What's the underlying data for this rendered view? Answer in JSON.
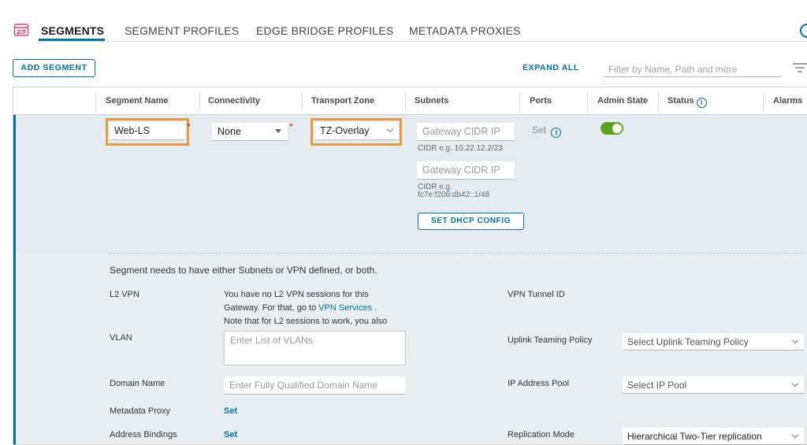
{
  "tabs": [
    {
      "label": "SEGMENTS",
      "active": true
    },
    {
      "label": "SEGMENT PROFILES",
      "active": false
    },
    {
      "label": "EDGE BRIDGE PROFILES",
      "active": false
    },
    {
      "label": "METADATA PROXIES",
      "active": false
    }
  ],
  "toolbar": {
    "add_label": "ADD SEGMENT",
    "expand_label": "EXPAND ALL",
    "filter_placeholder": "Filter by Name, Path and more"
  },
  "columns": {
    "segment_name": "Segment Name",
    "connectivity": "Connectivity",
    "transport_zone": "Transport Zone",
    "subnets": "Subnets",
    "ports": "Ports",
    "admin_state": "Admin State",
    "status": "Status",
    "alarms": "Alarms"
  },
  "row": {
    "segment_name": "Web-LS",
    "connectivity": "None",
    "transport_zone": "TZ-Overlay",
    "gateway_placeholder_1": "Gateway CIDR IP",
    "cidr_hint_1": "CIDR e.g. 10.22.12.2/23",
    "gateway_placeholder_2": "Gateway CIDR IP",
    "cidr_hint_2a": "CIDR e.g.",
    "cidr_hint_2b": "fc7e:f206:db42::1/48",
    "dhcp_label": "SET DHCP CONFIG",
    "ports_set": "Set",
    "admin_state_on": true,
    "required_mark": "*"
  },
  "details": {
    "note": "Segment needs to have either Subnets or VPN defined, or both.",
    "l2vpn_label": "L2 VPN",
    "l2vpn_text_1": "You have no L2 VPN sessions for this Gateway. For that, go to ",
    "l2vpn_link": "VPN Services",
    "l2vpn_text_2": " .",
    "l2vpn_text_3": "Note that for L2 sessions to work, you also",
    "vlan_label": "VLAN",
    "vlan_placeholder": "Enter List of VLANs",
    "domain_label": "Domain Name",
    "domain_placeholder": "Enter Fully Qualified Domain Name",
    "metadata_label": "Metadata Proxy",
    "metadata_value": "Set",
    "address_label": "Address Bindings",
    "address_value": "Set",
    "vpn_tunnel_label": "VPN Tunnel ID",
    "uplink_label": "Uplink Teaming Policy",
    "uplink_value": "Select Uplink Teaming Policy",
    "ip_pool_label": "IP Address Pool",
    "ip_pool_value": "Select IP Pool",
    "replication_label": "Replication Mode",
    "replication_value": "Hierarchical Two-Tier replication"
  },
  "colors": {
    "accent": "#0072a3",
    "highlight": "#e89a3c",
    "toggle_on": "#5aa220",
    "required": "#c92100"
  }
}
